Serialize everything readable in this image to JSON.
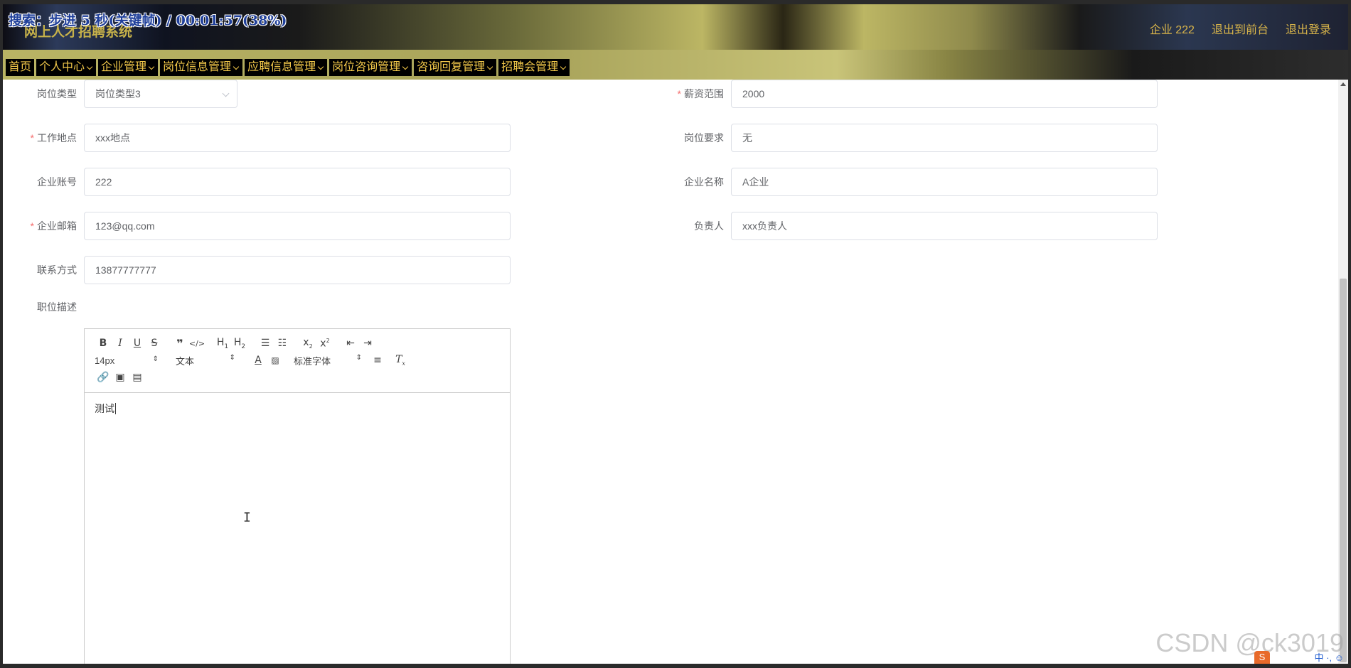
{
  "overlay": {
    "text": "搜索：步进 5 秒(关键帧) / 00:01:57(38%)"
  },
  "header": {
    "system_title": "网上人才招聘系统",
    "links": [
      "企业 222",
      "退出到前台",
      "退出登录"
    ]
  },
  "nav": {
    "items": [
      {
        "label": "首页",
        "has_dropdown": false
      },
      {
        "label": "个人中心",
        "has_dropdown": true
      },
      {
        "label": "企业管理",
        "has_dropdown": true
      },
      {
        "label": "岗位信息管理",
        "has_dropdown": true
      },
      {
        "label": "应聘信息管理",
        "has_dropdown": true
      },
      {
        "label": "岗位咨询管理",
        "has_dropdown": true
      },
      {
        "label": "咨询回复管理",
        "has_dropdown": true
      },
      {
        "label": "招聘会管理",
        "has_dropdown": true
      }
    ]
  },
  "form": {
    "job_type": {
      "label": "岗位类型",
      "value": "岗位类型3",
      "required": false
    },
    "salary": {
      "label": "薪资范围",
      "value": "2000",
      "required": true
    },
    "location": {
      "label": "工作地点",
      "value": "xxx地点",
      "required": true
    },
    "requirements": {
      "label": "岗位要求",
      "value": "无",
      "required": false
    },
    "account": {
      "label": "企业账号",
      "value": "222",
      "required": false
    },
    "company_name": {
      "label": "企业名称",
      "value": "A企业",
      "required": false
    },
    "email": {
      "label": "企业邮箱",
      "value": "123@qq.com",
      "required": true
    },
    "contact_person": {
      "label": "负责人",
      "value": "xxx负责人",
      "required": false
    },
    "phone": {
      "label": "联系方式",
      "value": "13877777777",
      "required": false
    },
    "description": {
      "label": "职位描述"
    }
  },
  "editor": {
    "font_size": "14px",
    "text_style": "文本",
    "font_family": "标准字体",
    "content": "测试"
  },
  "watermark": "CSDN @ck3019",
  "tray": {
    "icon_char": "S",
    "text": "中 ·, ☺"
  }
}
